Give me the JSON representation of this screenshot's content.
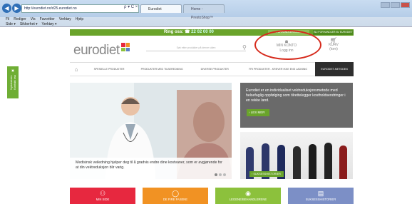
{
  "browser": {
    "address": "http://eurodiet.no/d25.eurodiet.no",
    "address_tools": "ρ ▾ C ×",
    "tabs": [
      {
        "label": "Eurodiet"
      },
      {
        "label": "Home - PrestoShop™"
      }
    ],
    "menu": [
      "Fil",
      "Rediger",
      "Vis",
      "Favoritter",
      "Verktøy",
      "Hjelp"
    ],
    "favorites": [
      "Side ▾",
      "Sikkerhet ▾",
      "Verktøy ▾"
    ]
  },
  "topbar": {
    "ring_label": "Ring oss:",
    "phone": "22 02 00 00",
    "retail_button": "FORHANDLERLOGIN",
    "ketail_button": "BLI FORHANDLER AV EURODIET"
  },
  "header": {
    "logo": "eurodiet",
    "logo_colors": [
      "#e7283f",
      "#f19223",
      "#8cc13c",
      "#5b7fc4"
    ],
    "search_placeholder": "Søk etter produkter på denne siden",
    "account_title": "MIN KONTO",
    "account_sub": "Logg inn",
    "cart_title": "KURV",
    "cart_sub": "(tom)"
  },
  "nav": {
    "items": [
      "SPESIELLE PRODUKTER",
      "PRODUKTER MED TILBEREDNING",
      "DIVERSE PRODUKTER",
      "FRI PRODUKTER - KREVER IKKE ENS LADNING",
      "EURODIET-METODEN"
    ]
  },
  "sidetab": {
    "title": "Nyhetsbrev",
    "sub": "Kontakt oss"
  },
  "hero": {
    "caption": "Medisinsk veiledning hjelper deg til å gradvis endre dine kostvaner, som er avgjørende for at din vektreduksjon blir varig."
  },
  "info": {
    "text": "Eurodiet er en individualiset vektreduksjonsmetode med helsefaglig oppfølging som tilrettelegger kostholdsendringer i en rekke land.",
    "button": "› LES MER"
  },
  "photo": {
    "button": "› SUKSESSHISTORIER"
  },
  "tiles": [
    {
      "label": "MIN SIDE",
      "icon": "person-icon"
    },
    {
      "label": "DE FIRE FASENE",
      "icon": "chat-icon"
    },
    {
      "label": "LEGENE/BEHANDLERENE",
      "icon": "location-icon"
    },
    {
      "label": "SUKSESSHISTORIER",
      "icon": "document-icon"
    }
  ]
}
